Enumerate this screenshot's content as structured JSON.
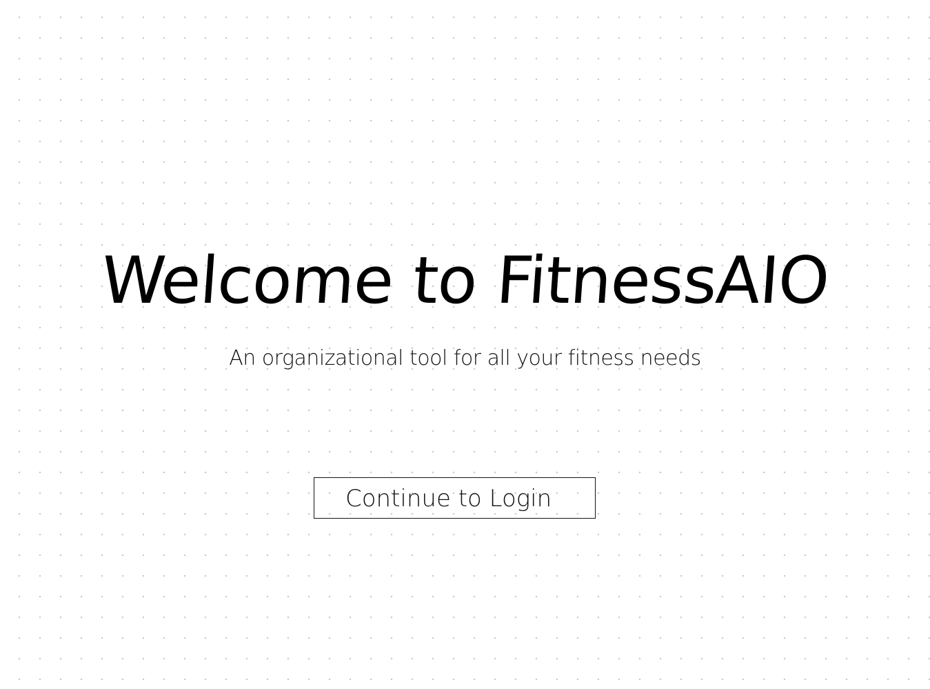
{
  "page": {
    "title": "Welcome to FitnessAIO",
    "subtitle": "An organizational tool for all your fitness needs"
  },
  "actions": {
    "continue_label": "Continue to Login"
  },
  "colors": {
    "ink": "#000000",
    "background": "#ffffff",
    "grid_dot": "#c9c9c9"
  }
}
